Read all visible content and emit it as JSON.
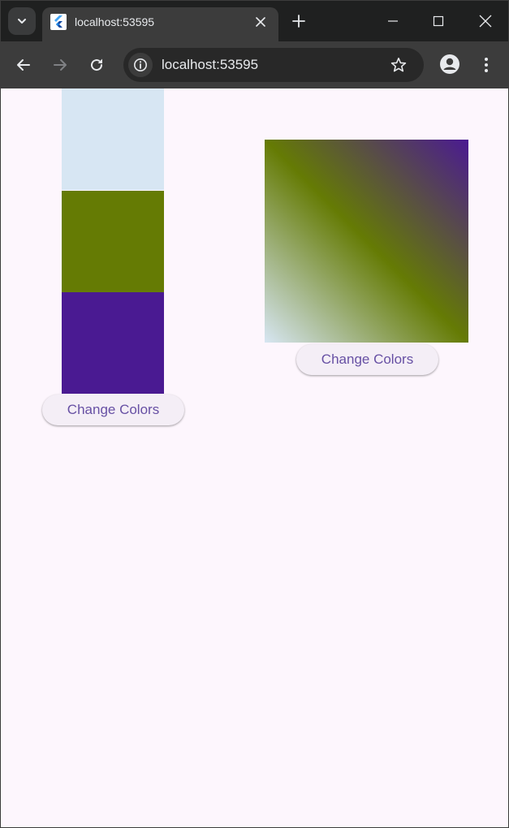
{
  "browser": {
    "tab_title": "localhost:53595",
    "url": "localhost:53595"
  },
  "app": {
    "stack_colors": [
      "#d7e6f3",
      "#657b04",
      "#4a1a92"
    ],
    "gradient_colors": [
      "#d7e6f3",
      "#657b04",
      "#4a1a92"
    ],
    "left_button_label": "Change Colors",
    "right_button_label": "Change Colors"
  },
  "icons": {
    "tab_search": "chevron-down-icon",
    "favicon": "flutter-logo-icon",
    "tab_close": "close-icon",
    "new_tab": "plus-icon",
    "minimize": "minimize-icon",
    "maximize": "maximize-icon",
    "close_window": "close-icon",
    "back": "arrow-left-icon",
    "forward": "arrow-right-icon",
    "reload": "reload-icon",
    "site_info": "info-icon",
    "bookmark": "star-icon",
    "profile": "profile-icon",
    "menu": "kebab-menu-icon"
  }
}
